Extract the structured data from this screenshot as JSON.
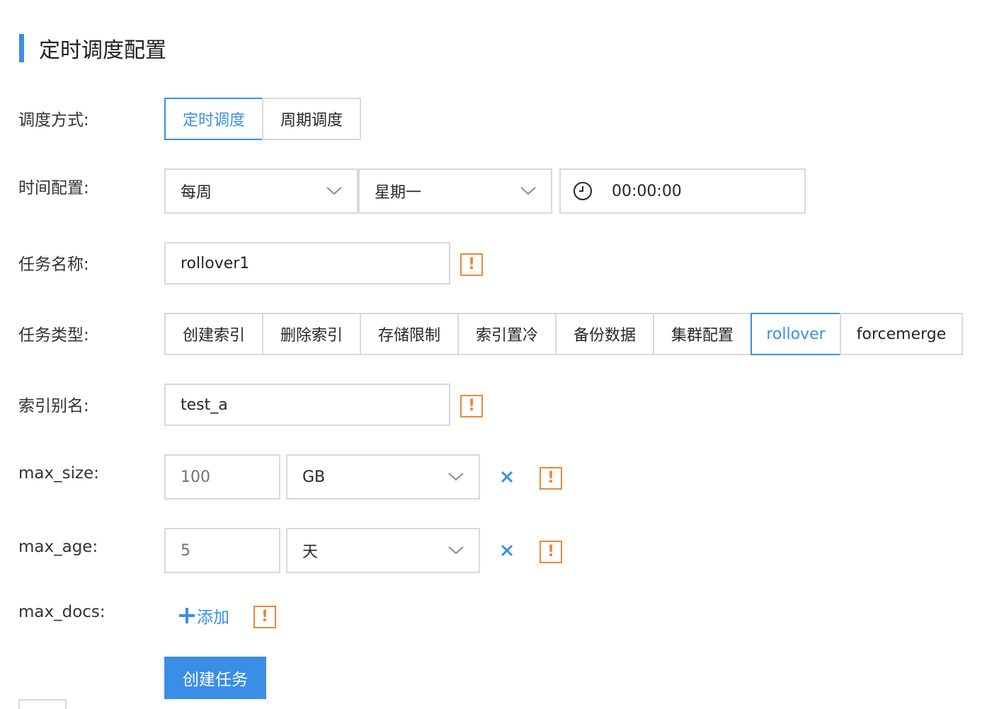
{
  "section": {
    "title": "定时调度配置"
  },
  "form": {
    "schedule_mode": {
      "label": "调度方式:",
      "options": [
        {
          "label": "定时调度",
          "active": true
        },
        {
          "label": "周期调度",
          "active": false
        }
      ]
    },
    "time_config": {
      "label": "时间配置:",
      "frequency": "每周",
      "weekday": "星期一",
      "time": "00:00:00"
    },
    "task_name": {
      "label": "任务名称:",
      "value": "rollover1"
    },
    "task_type": {
      "label": "任务类型:",
      "options": [
        {
          "label": "创建索引",
          "active": false
        },
        {
          "label": "删除索引",
          "active": false
        },
        {
          "label": "存储限制",
          "active": false
        },
        {
          "label": "索引置冷",
          "active": false
        },
        {
          "label": "备份数据",
          "active": false
        },
        {
          "label": "集群配置",
          "active": false
        },
        {
          "label": "rollover",
          "active": true
        },
        {
          "label": "forcemerge",
          "active": false
        }
      ]
    },
    "index_alias": {
      "label": "索引别名:",
      "value": "test_a"
    },
    "max_size": {
      "label": "max_size:",
      "value": "100",
      "unit": "GB"
    },
    "max_age": {
      "label": "max_age:",
      "value": "5",
      "unit": "天"
    },
    "max_docs": {
      "label": "max_docs:",
      "add_label": "添加"
    },
    "warn_glyph": "!",
    "submit_label": "创建任务"
  },
  "colors": {
    "accent": "#3a8ee6",
    "warning": "#e8893a",
    "border": "#d9d9d9"
  }
}
